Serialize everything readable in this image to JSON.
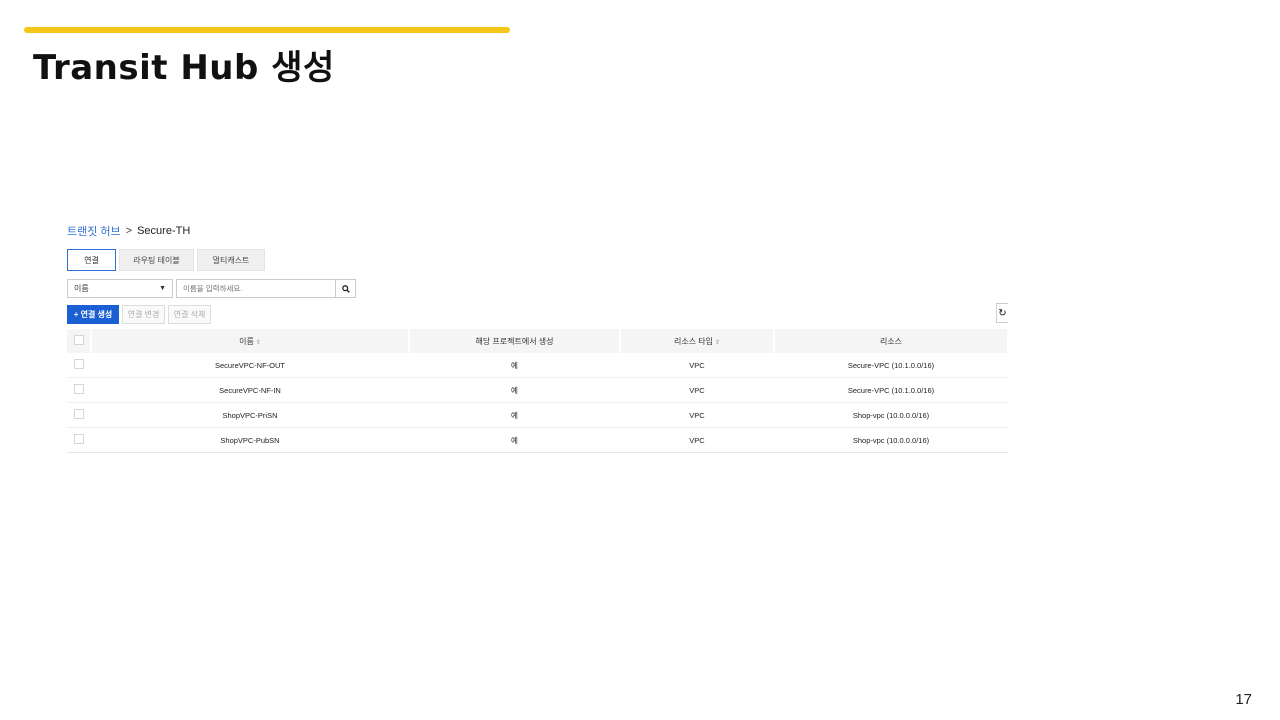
{
  "slide": {
    "title": "Transit Hub 생성",
    "page_number": "17",
    "accent_color": "#f5c518"
  },
  "breadcrumb": {
    "parent": "트랜짓 허브",
    "separator": ">",
    "current": "Secure-TH"
  },
  "tabs": [
    {
      "label": "연결",
      "active": true
    },
    {
      "label": "라우팅 테이블",
      "active": false
    },
    {
      "label": "멀티캐스트",
      "active": false
    }
  ],
  "filter": {
    "select_value": "이름",
    "search_placeholder": "이름을 입력하세요."
  },
  "actions": {
    "create": "+ 연결 생성",
    "edit": "연결 변경",
    "delete": "연결 삭제",
    "refresh_icon": "refresh-icon",
    "primary_color": "#1a5fd3"
  },
  "table": {
    "columns": [
      "",
      "이름",
      "해당 프로젝트에서 생성",
      "리소스 타입",
      "리소스"
    ],
    "sortable": [
      false,
      true,
      false,
      true,
      false
    ],
    "rows": [
      {
        "name": "SecureVPC-NF-OUT",
        "created_here": "예",
        "resource_type": "VPC",
        "resource": "Secure-VPC (10.1.0.0/16)"
      },
      {
        "name": "SecureVPC-NF-IN",
        "created_here": "예",
        "resource_type": "VPC",
        "resource": "Secure-VPC (10.1.0.0/16)"
      },
      {
        "name": "ShopVPC-PriSN",
        "created_here": "예",
        "resource_type": "VPC",
        "resource": "Shop-vpc (10.0.0.0/16)"
      },
      {
        "name": "ShopVPC-PubSN",
        "created_here": "예",
        "resource_type": "VPC",
        "resource": "Shop-vpc (10.0.0.0/16)"
      }
    ]
  }
}
